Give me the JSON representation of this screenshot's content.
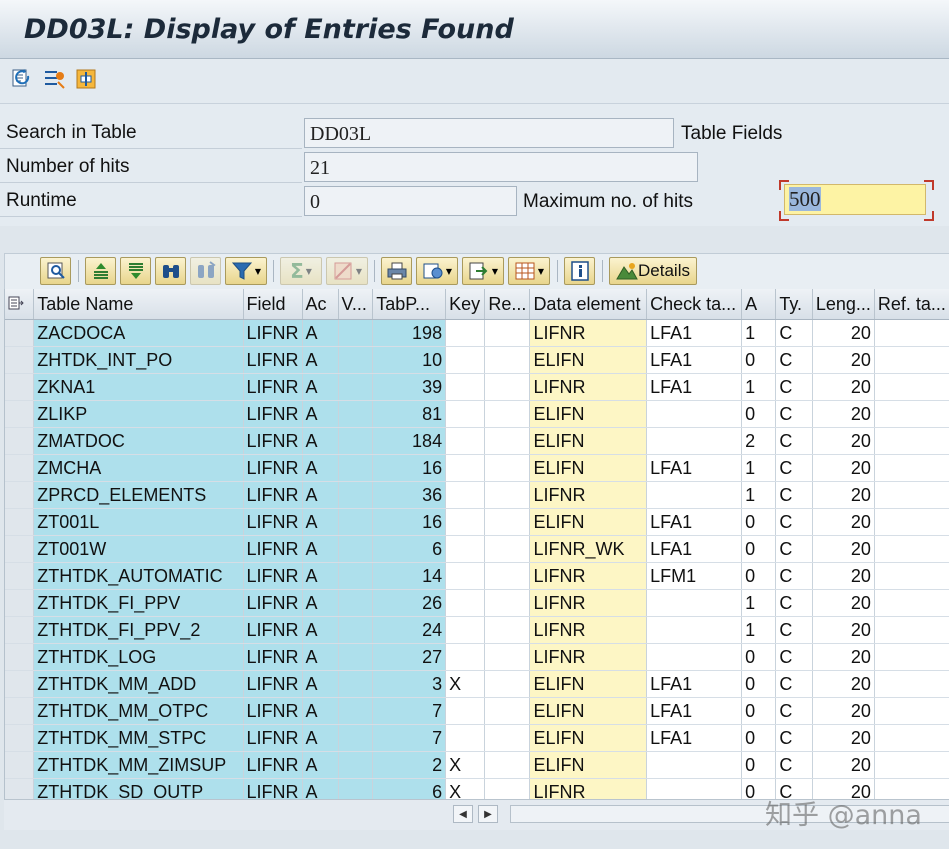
{
  "window": {
    "title": "DD03L: Display of Entries Found"
  },
  "toolbar": {
    "icons": [
      "refresh-icon",
      "selection-options-icon",
      "change-settings-icon"
    ]
  },
  "form": {
    "search_in_table_label": "Search in Table",
    "search_in_table_value": "DD03L",
    "table_fields_label": "Table Fields",
    "number_of_hits_label": "Number of hits",
    "number_of_hits_value": "21",
    "runtime_label": "Runtime",
    "runtime_value": "0",
    "max_hits_label": "Maximum no. of hits",
    "max_hits_value": "500"
  },
  "alv_toolbar": {
    "details_label": "Details"
  },
  "grid": {
    "columns": [
      "Table Name",
      "Field",
      "Ac",
      "V...",
      "TabP...",
      "Key",
      "Re...",
      "Data element",
      "Check ta...",
      "A",
      "Ty.",
      "Leng...",
      "Ref. ta..."
    ],
    "rows": [
      [
        "ZACDOCA",
        "LIFNR",
        "A",
        "",
        "198",
        "",
        "",
        "LIFNR",
        "LFA1",
        "1",
        "C",
        "20",
        ""
      ],
      [
        "ZHTDK_INT_PO",
        "LIFNR",
        "A",
        "",
        "10",
        "",
        "",
        "ELIFN",
        "LFA1",
        "0",
        "C",
        "20",
        ""
      ],
      [
        "ZKNA1",
        "LIFNR",
        "A",
        "",
        "39",
        "",
        "",
        "LIFNR",
        "LFA1",
        "1",
        "C",
        "20",
        ""
      ],
      [
        "ZLIKP",
        "LIFNR",
        "A",
        "",
        "81",
        "",
        "",
        "ELIFN",
        "",
        "0",
        "C",
        "20",
        ""
      ],
      [
        "ZMATDOC",
        "LIFNR",
        "A",
        "",
        "184",
        "",
        "",
        "ELIFN",
        "",
        "2",
        "C",
        "20",
        ""
      ],
      [
        "ZMCHA",
        "LIFNR",
        "A",
        "",
        "16",
        "",
        "",
        "ELIFN",
        "LFA1",
        "1",
        "C",
        "20",
        ""
      ],
      [
        "ZPRCD_ELEMENTS",
        "LIFNR",
        "A",
        "",
        "36",
        "",
        "",
        "LIFNR",
        "",
        "1",
        "C",
        "20",
        ""
      ],
      [
        "ZT001L",
        "LIFNR",
        "A",
        "",
        "16",
        "",
        "",
        "ELIFN",
        "LFA1",
        "0",
        "C",
        "20",
        ""
      ],
      [
        "ZT001W",
        "LIFNR",
        "A",
        "",
        "6",
        "",
        "",
        "LIFNR_WK",
        "LFA1",
        "0",
        "C",
        "20",
        ""
      ],
      [
        "ZTHTDK_AUTOMATIC",
        "LIFNR",
        "A",
        "",
        "14",
        "",
        "",
        "LIFNR",
        "LFM1",
        "0",
        "C",
        "20",
        ""
      ],
      [
        "ZTHTDK_FI_PPV",
        "LIFNR",
        "A",
        "",
        "26",
        "",
        "",
        "LIFNR",
        "",
        "1",
        "C",
        "20",
        ""
      ],
      [
        "ZTHTDK_FI_PPV_2",
        "LIFNR",
        "A",
        "",
        "24",
        "",
        "",
        "LIFNR",
        "",
        "1",
        "C",
        "20",
        ""
      ],
      [
        "ZTHTDK_LOG",
        "LIFNR",
        "A",
        "",
        "27",
        "",
        "",
        "LIFNR",
        "",
        "0",
        "C",
        "20",
        ""
      ],
      [
        "ZTHTDK_MM_ADD",
        "LIFNR",
        "A",
        "",
        "3",
        "X",
        "",
        "ELIFN",
        "LFA1",
        "0",
        "C",
        "20",
        ""
      ],
      [
        "ZTHTDK_MM_OTPC",
        "LIFNR",
        "A",
        "",
        "7",
        "",
        "",
        "ELIFN",
        "LFA1",
        "0",
        "C",
        "20",
        ""
      ],
      [
        "ZTHTDK_MM_STPC",
        "LIFNR",
        "A",
        "",
        "7",
        "",
        "",
        "ELIFN",
        "LFA1",
        "0",
        "C",
        "20",
        ""
      ],
      [
        "ZTHTDK_MM_ZIMSUP",
        "LIFNR",
        "A",
        "",
        "2",
        "X",
        "",
        "ELIFN",
        "",
        "0",
        "C",
        "20",
        ""
      ],
      [
        "ZTHTDK_SD_OUTP",
        "LIFNR",
        "A",
        "",
        "6",
        "X",
        "",
        "LIFNR",
        "",
        "0",
        "C",
        "20",
        ""
      ]
    ]
  },
  "watermark": "知乎 @anna"
}
